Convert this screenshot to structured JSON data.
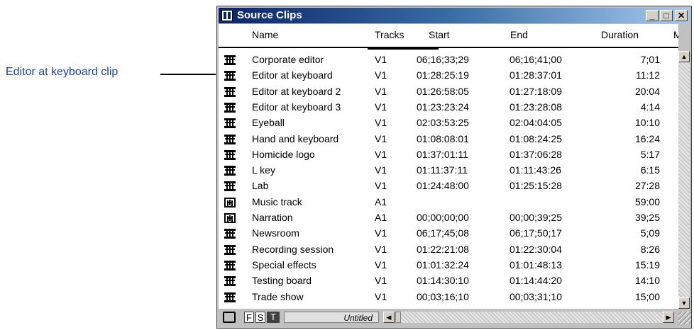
{
  "callout": {
    "label": "Editor at keyboard clip"
  },
  "window": {
    "title": "Source Clips",
    "min": "_",
    "max": "□",
    "close": "✕"
  },
  "columns": {
    "name": "Name",
    "tracks": "Tracks",
    "start": "Start",
    "end": "End",
    "duration": "Duration",
    "more": "M"
  },
  "rows": [
    {
      "type": "video",
      "name": "Corporate editor",
      "tracks": "V1",
      "start": "06;16;33;29",
      "end": "06;16;41;00",
      "duration": "7;01"
    },
    {
      "type": "video",
      "name": "Editor at keyboard",
      "tracks": "V1",
      "start": "01:28:25:19",
      "end": "01:28:37:01",
      "duration": "11:12"
    },
    {
      "type": "video",
      "name": "Editor at keyboard 2",
      "tracks": "V1",
      "start": "01:26:58:05",
      "end": "01:27:18:09",
      "duration": "20:04"
    },
    {
      "type": "video",
      "name": "Editor at keyboard 3",
      "tracks": "V1",
      "start": "01:23:23:24",
      "end": "01:23:28:08",
      "duration": "4:14"
    },
    {
      "type": "video",
      "name": "Eyeball",
      "tracks": "V1",
      "start": "02:03:53:25",
      "end": "02:04:04:05",
      "duration": "10:10"
    },
    {
      "type": "video",
      "name": "Hand and keyboard",
      "tracks": "V1",
      "start": "01:08:08:01",
      "end": "01:08:24:25",
      "duration": "16:24"
    },
    {
      "type": "video",
      "name": "Homicide logo",
      "tracks": "V1",
      "start": "01:37:01:11",
      "end": "01:37:06:28",
      "duration": "5:17"
    },
    {
      "type": "video",
      "name": "L key",
      "tracks": "V1",
      "start": "01:11:37:11",
      "end": "01:11:43:26",
      "duration": "6:15"
    },
    {
      "type": "video",
      "name": "Lab",
      "tracks": "V1",
      "start": "01:24:48:00",
      "end": "01:25:15:28",
      "duration": "27:28"
    },
    {
      "type": "audio",
      "name": "Music track",
      "tracks": "A1",
      "start": "",
      "end": "",
      "duration": "59:00"
    },
    {
      "type": "audio",
      "name": "Narration",
      "tracks": "A1",
      "start": "00;00;00;00",
      "end": "00;00;39;25",
      "duration": "39;25"
    },
    {
      "type": "video",
      "name": "Newsroom",
      "tracks": "V1",
      "start": "06;17;45;08",
      "end": "06;17;50;17",
      "duration": "5;09"
    },
    {
      "type": "video",
      "name": "Recording session",
      "tracks": "V1",
      "start": "01:22:21:08",
      "end": "01:22:30:04",
      "duration": "8:26"
    },
    {
      "type": "video",
      "name": "Special effects",
      "tracks": "V1",
      "start": "01:01:32:24",
      "end": "01:01:48:13",
      "duration": "15:19"
    },
    {
      "type": "video",
      "name": "Testing board",
      "tracks": "V1",
      "start": "01:14:30:10",
      "end": "01:14:44:20",
      "duration": "14:10"
    },
    {
      "type": "video",
      "name": "Trade show",
      "tracks": "V1",
      "start": "00;03;16;10",
      "end": "00;03;31;10",
      "duration": "15;00"
    }
  ],
  "bottom": {
    "f": "F",
    "s": "S",
    "t": "T",
    "view_name": "Untitled",
    "left_arrow": "◀",
    "right_arrow": "▶"
  },
  "scroll": {
    "up_arrow": "▲",
    "down_arrow": "▼"
  }
}
